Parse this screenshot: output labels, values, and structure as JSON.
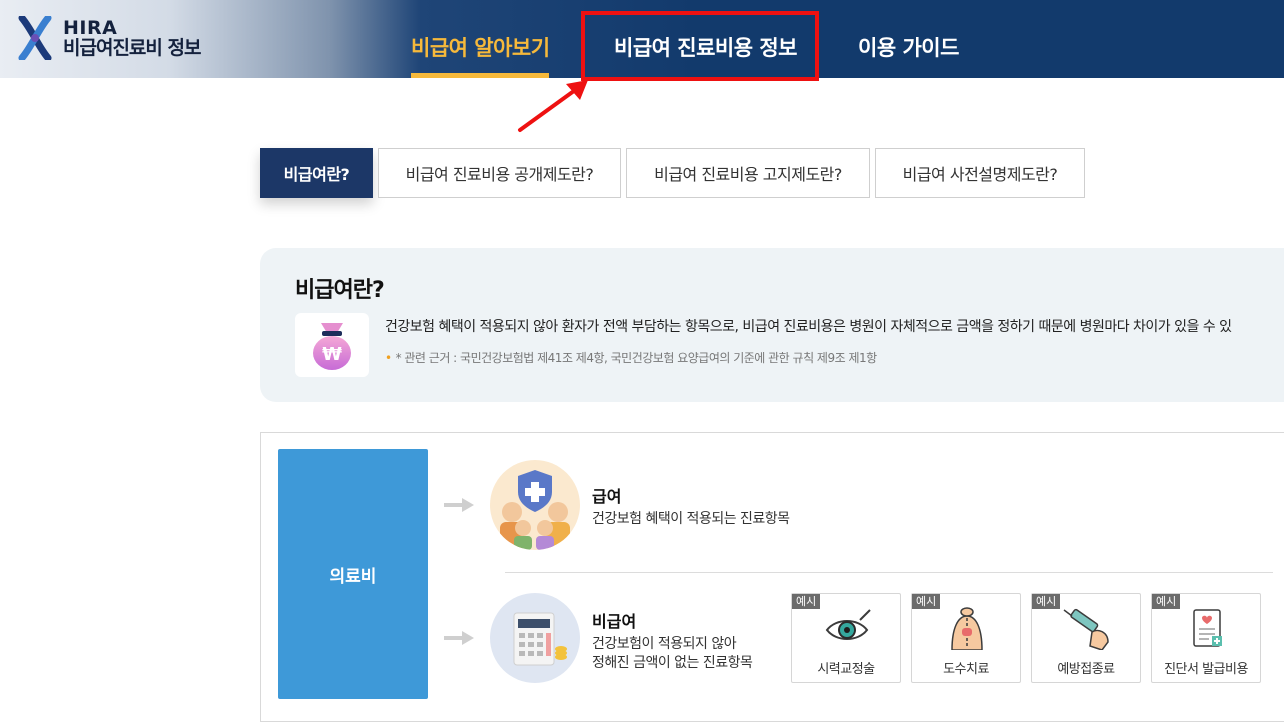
{
  "header": {
    "logo_line1": "HIRA",
    "logo_line2": "비급여진료비 정보",
    "nav": [
      {
        "label": "비급여 알아보기",
        "active": true
      },
      {
        "label": "비급여 진료비용 정보",
        "highlighted": true
      },
      {
        "label": "이용 가이드"
      }
    ],
    "active_color": "#f6b93b",
    "bg_color": "#123a6c",
    "highlight_color": "#ee1111"
  },
  "tabs": [
    {
      "label": "비급여란?",
      "active": true
    },
    {
      "label": "비급여 진료비용 공개제도란?"
    },
    {
      "label": "비급여 진료비용 고지제도란?"
    },
    {
      "label": "비급여 사전설명제도란?"
    }
  ],
  "info": {
    "title": "비급여란?",
    "description": "건강보험 혜택이 적용되지 않아 환자가 전액 부담하는 항목으로, 비급여 진료비용은 병원이 자체적으로 금액을 정하기 때문에 병원마다 차이가 있을 수 있",
    "note": "* 관련 근거 : 국민건강보험법 제41조 제4항, 국민건강보험 요양급여의 기준에 관한 규칙 제9조 제1항"
  },
  "diagram": {
    "root_label": "의료비",
    "covered": {
      "title": "급여",
      "desc": "건강보험 혜택이 적용되는 진료항목"
    },
    "noncovered": {
      "title": "비급여",
      "desc_line1": "건강보험이 적용되지 않아",
      "desc_line2": "정해진 금액이 없는 진료항목"
    },
    "examples": [
      {
        "badge": "예시",
        "label": "시력교정술",
        "icon": "eye-icon"
      },
      {
        "badge": "예시",
        "label": "도수치료",
        "icon": "back-therapy-icon"
      },
      {
        "badge": "예시",
        "label": "예방접종료",
        "icon": "syringe-icon"
      },
      {
        "badge": "예시",
        "label": "진단서 발급비용",
        "icon": "certificate-icon"
      }
    ]
  }
}
